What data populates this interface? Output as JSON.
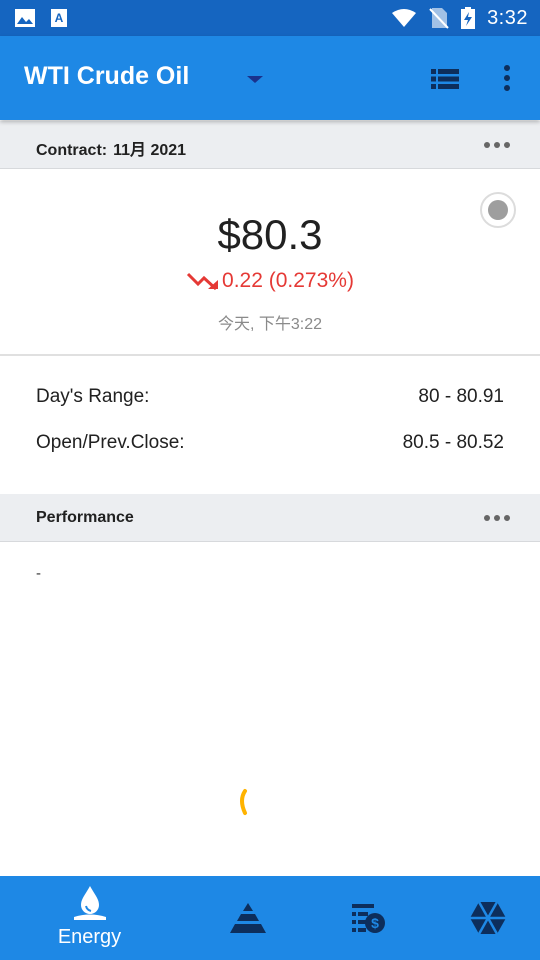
{
  "status_bar": {
    "time": "3:32",
    "left_icons": [
      "image-icon",
      "text-a-icon"
    ],
    "right_icons": [
      "wifi-icon",
      "no-sim-icon",
      "battery-charging-icon"
    ]
  },
  "app_bar": {
    "title": "WTI Crude Oil",
    "icons": [
      "dropdown-icon",
      "list-view-icon",
      "more-vert-icon"
    ]
  },
  "contract": {
    "label": "Contract:",
    "value": "11月 2021"
  },
  "quote": {
    "price": "$80.3",
    "change": "0.22 (0.273%)",
    "direction": "down",
    "timestamp": "今天, 下午3:22"
  },
  "ranges": [
    {
      "label": "Day's Range:",
      "value": "80 - 80.91"
    },
    {
      "label": "Open/Prev.Close:",
      "value": "80.5 - 80.52"
    }
  ],
  "performance": {
    "label": "Performance",
    "body": "-"
  },
  "bottom_nav": {
    "items": [
      {
        "label": "Energy",
        "icon": "water-drop-icon",
        "active": true
      },
      {
        "label": "",
        "icon": "pyramid-icon",
        "active": false
      },
      {
        "label": "",
        "icon": "money-list-icon",
        "active": false
      },
      {
        "label": "",
        "icon": "hexagon-icon",
        "active": false
      }
    ]
  },
  "colors": {
    "status_bar": "#1565c0",
    "app_bar": "#1e88e5",
    "negative": "#e53935",
    "spinner": "#ffb300",
    "nav_icon_dark": "#0d2e5c"
  }
}
